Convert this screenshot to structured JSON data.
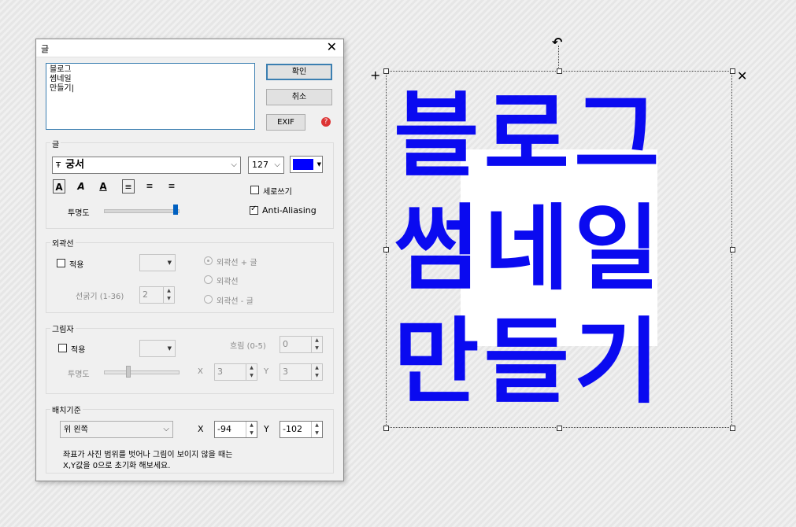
{
  "dialog": {
    "title": "글",
    "close_glyph": "✕",
    "text_value": "블로그\n썸네일\n만들기|",
    "ok_label": "확인",
    "cancel_label": "취소",
    "exif_label": "EXIF",
    "help_icon": "help-icon"
  },
  "font_group": {
    "label": "글",
    "font_name": "궁서",
    "font_icon": "Ŧ",
    "size_value": "127",
    "color": "#0000ff",
    "style_bold": "A",
    "style_italic": "A",
    "style_underline": "A",
    "vertical_label": "세로쓰기",
    "opacity_label": "투명도",
    "opacity_value": 100,
    "antialias_label": "Anti-Aliasing",
    "vertical_checked": false,
    "antialias_checked": true
  },
  "outline_group": {
    "label": "외곽선",
    "apply_label": "적용",
    "thickness_label": "선굵기 (1-36)",
    "thickness_value": "2",
    "option_1": "외곽선 + 글",
    "option_2": "외곽선",
    "option_3": "외곽선 - 글"
  },
  "shadow_group": {
    "label": "그림자",
    "apply_label": "적용",
    "blur_label": "흐림 (0-5)",
    "blur_value": "0",
    "opacity_label": "투명도",
    "x_label": "X",
    "x_value": "3",
    "y_label": "Y",
    "y_value": "3"
  },
  "position_group": {
    "label": "배치기준",
    "anchor_value": "위 왼쪽",
    "x_label": "X",
    "x_value": "-94",
    "y_label": "Y",
    "y_value": "-102",
    "note_line1": "좌표가 사진 범위를 벗어나 그림이 보이지 않을 때는",
    "note_line2": "X,Y값을 0으로 초기화 해보세요."
  },
  "canvas": {
    "line1": "블로그",
    "line2": "썸네일",
    "line3": "만들기",
    "text_color": "#0a0af0",
    "rotate_glyph": "↶",
    "move_glyph": "+",
    "delete_glyph": "✕"
  }
}
